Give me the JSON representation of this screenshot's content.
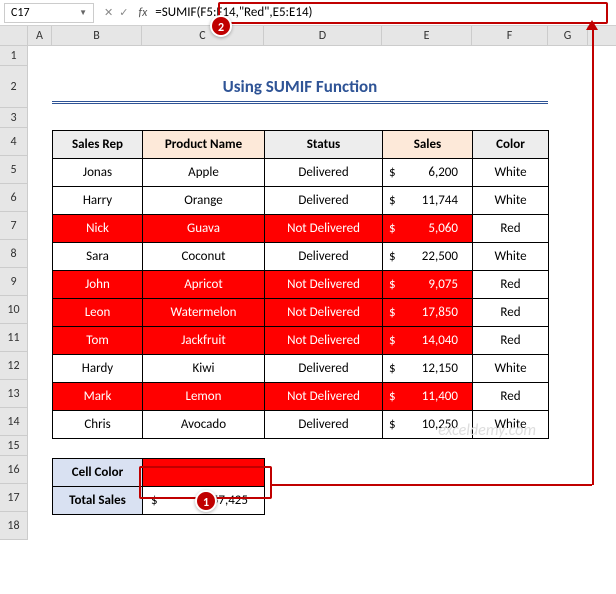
{
  "namebox": "C17",
  "formula": "=SUMIF(F5:F14,\"Red\",E5:E14)",
  "fx_label": "fx",
  "cols": [
    "A",
    "B",
    "C",
    "D",
    "E",
    "F",
    "G"
  ],
  "rows": [
    "1",
    "2",
    "3",
    "4",
    "5",
    "6",
    "7",
    "8",
    "9",
    "10",
    "11",
    "12",
    "13",
    "14",
    "15",
    "16",
    "17",
    "18"
  ],
  "title": "Using SUMIF Function",
  "headers": {
    "rep": "Sales Rep",
    "prod": "Product Name",
    "stat": "Status",
    "sales": "Sales",
    "color": "Color"
  },
  "data": [
    {
      "rep": "Jonas",
      "prod": "Apple",
      "stat": "Delivered",
      "sales": "6,200",
      "color": "White",
      "red": false
    },
    {
      "rep": "Harry",
      "prod": "Orange",
      "stat": "Delivered",
      "sales": "11,744",
      "color": "White",
      "red": false
    },
    {
      "rep": "Nick",
      "prod": "Guava",
      "stat": "Not Delivered",
      "sales": "5,060",
      "color": "Red",
      "red": true
    },
    {
      "rep": "Sara",
      "prod": "Coconut",
      "stat": "Delivered",
      "sales": "22,500",
      "color": "White",
      "red": false
    },
    {
      "rep": "John",
      "prod": "Apricot",
      "stat": "Not Delivered",
      "sales": "9,075",
      "color": "Red",
      "red": true
    },
    {
      "rep": "Leon",
      "prod": "Watermelon",
      "stat": "Not Delivered",
      "sales": "17,850",
      "color": "Red",
      "red": true
    },
    {
      "rep": "Tom",
      "prod": "Jackfruit",
      "stat": "Not Delivered",
      "sales": "14,040",
      "color": "Red",
      "red": true
    },
    {
      "rep": "Hardy",
      "prod": "Kiwi",
      "stat": "Delivered",
      "sales": "12,150",
      "color": "White",
      "red": false
    },
    {
      "rep": "Mark",
      "prod": "Lemon",
      "stat": "Not Delivered",
      "sales": "11,400",
      "color": "Red",
      "red": true
    },
    {
      "rep": "Chris",
      "prod": "Avocado",
      "stat": "Delivered",
      "sales": "10,250",
      "color": "White",
      "red": false
    }
  ],
  "currency": "$",
  "summary": {
    "cellcolor_lbl": "Cell Color",
    "total_lbl": "Total Sales",
    "total_val": "57,425"
  },
  "watermark": "exceldemy.com",
  "badges": {
    "b1": "1",
    "b2": "2"
  }
}
